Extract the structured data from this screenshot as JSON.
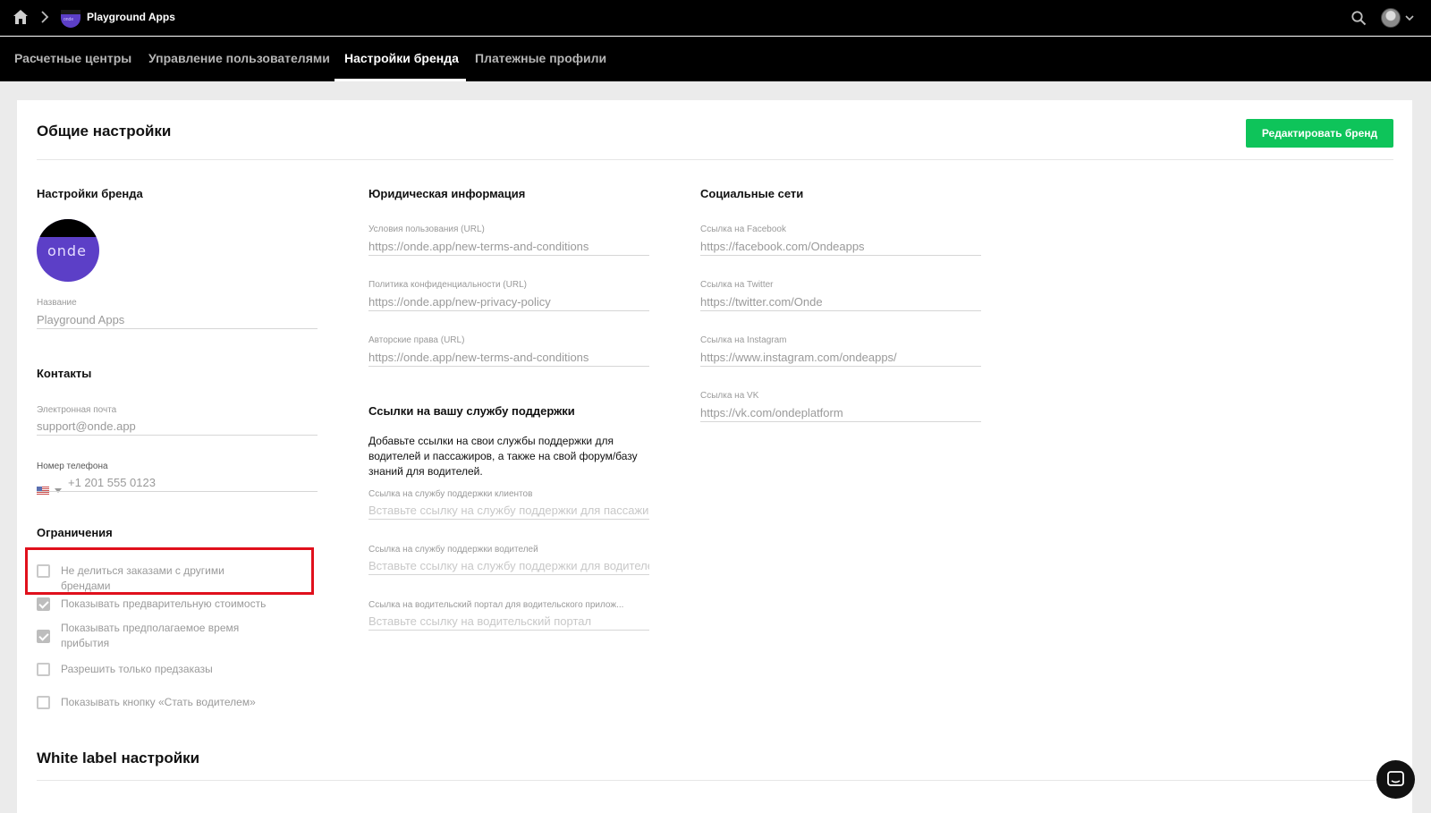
{
  "header": {
    "app_name": "Playground Apps",
    "app_logo_text": "onde"
  },
  "tabs": [
    {
      "label": "Расчетные центры",
      "active": false
    },
    {
      "label": "Управление пользователями",
      "active": false
    },
    {
      "label": "Настройки бренда",
      "active": true
    },
    {
      "label": "Платежные профили",
      "active": false
    }
  ],
  "general": {
    "title": "Общие настройки",
    "edit_button": "Редактировать бренд"
  },
  "brand": {
    "title": "Настройки бренда",
    "logo_text": "onde",
    "name_label": "Название",
    "name_value": "Playground Apps"
  },
  "contacts": {
    "title": "Контакты",
    "email_label": "Электронная почта",
    "email_value": "support@onde.app",
    "phone_label": "Номер телефона",
    "phone_value": "+1 201 555 0123"
  },
  "restrictions": {
    "title": "Ограничения",
    "items": [
      {
        "label": "Не делиться заказами с другими брендами",
        "checked": false
      },
      {
        "label": "Показывать предварительную стоимость",
        "checked": true
      },
      {
        "label": "Показывать предполагаемое время прибытия",
        "checked": true
      },
      {
        "label": "Разрешить только предзаказы",
        "checked": false
      },
      {
        "label": "Показывать кнопку «Стать водителем»",
        "checked": false
      }
    ]
  },
  "legal": {
    "title": "Юридическая информация",
    "terms_label": "Условия пользования (URL)",
    "terms_value": "https://onde.app/new-terms-and-conditions",
    "privacy_label": "Политика конфиденциальности (URL)",
    "privacy_value": "https://onde.app/new-privacy-policy",
    "copyright_label": "Авторские права (URL)",
    "copyright_value": "https://onde.app/new-terms-and-conditions"
  },
  "support": {
    "title": "Ссылки на вашу службу поддержки",
    "description": "Добавьте ссылки на свои службы поддержки для водителей и пассажиров, а также на свой форум/базу знаний для водителей.",
    "clients_label": "Ссылка на службу поддержки клиентов",
    "clients_placeholder": "Вставьте ссылку на службу поддержки для пассажиров",
    "drivers_label": "Ссылка на службу поддержки водителей",
    "drivers_placeholder": "Вставьте ссылку на службу поддержки для водителей",
    "portal_label": "Ссылка на водительский портал для водительского прилож...",
    "portal_placeholder": "Вставьте ссылку на водительский портал"
  },
  "social": {
    "title": "Социальные сети",
    "facebook_label": "Ссылка на Facebook",
    "facebook_value": "https://facebook.com/Ondeapps",
    "twitter_label": "Ссылка на Twitter",
    "twitter_value": "https://twitter.com/Onde",
    "instagram_label": "Ссылка на Instagram",
    "instagram_value": "https://www.instagram.com/ondeapps/",
    "vk_label": "Ссылка на VK",
    "vk_value": "https://vk.com/ondeplatform"
  },
  "whitelabel": {
    "title": "White label настройки"
  },
  "colors": {
    "accent_green": "#0ec45a",
    "brand_purple": "#5c3fc7",
    "highlight_red": "#e0101c"
  }
}
